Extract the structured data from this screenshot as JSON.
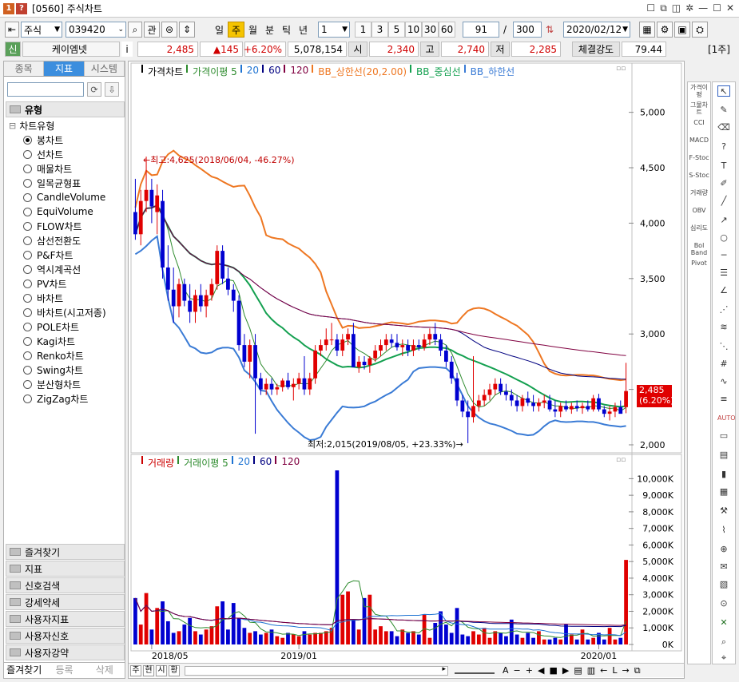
{
  "window": {
    "icon_num": "1",
    "icon_q": "?",
    "title": "[0560] 주식차트"
  },
  "toolbar": {
    "market": "주식",
    "code": "039420",
    "btn_gwan": "관",
    "periods": [
      "일",
      "주",
      "월",
      "분",
      "틱",
      "년"
    ],
    "period_active": "주",
    "interval": "1",
    "quick": [
      "1",
      "3",
      "5",
      "10",
      "30",
      "60"
    ],
    "count": "91",
    "count_sep": "/",
    "total": "300",
    "date": "2020/02/12"
  },
  "quote": {
    "tag": "신",
    "name": "케이엠넷",
    "info": "i",
    "price": "2,485",
    "change": "▲145",
    "change_pct": "+6.20%",
    "volume": "5,078,154",
    "open_label": "시",
    "open": "2,340",
    "high_label": "고",
    "high": "2,740",
    "low_label": "저",
    "low": "2,285",
    "strength_label": "체결강도",
    "strength": "79.44",
    "unit": "[1주]"
  },
  "sidebar": {
    "tabs": [
      "종목",
      "지표",
      "시스템"
    ],
    "active_tab": "지표",
    "group_title": "유형",
    "tree_root": "차트유형",
    "items": [
      "봉차트",
      "선차트",
      "매물차트",
      "일목균형표",
      "CandleVolume",
      "EquiVolume",
      "FLOW차트",
      "삼선전환도",
      "P&F차트",
      "역시계곡선",
      "PV차트",
      "바차트",
      "바차트(시고저종)",
      "POLE차트",
      "Kagi차트",
      "Renko차트",
      "Swing차트",
      "분산형차트",
      "ZigZag차트"
    ],
    "selected": "봉차트",
    "groups": [
      "즐겨찾기",
      "지표",
      "신호검색",
      "강세약세",
      "사용자지표",
      "사용자신호",
      "사용자강약"
    ],
    "bottom_tabs": [
      "즐겨찾기",
      "등록",
      "삭제"
    ]
  },
  "price_panel": {
    "legend": [
      {
        "text": "가격차트",
        "color": "#000000"
      },
      {
        "text": "가격이평 5",
        "color": "#2e8b2e"
      },
      {
        "text": "20",
        "color": "#1e73d2"
      },
      {
        "text": "60",
        "color": "#000080"
      },
      {
        "text": "120",
        "color": "#800040"
      },
      {
        "text": "BB_상한선(20,2.00)",
        "color": "#ee7722"
      },
      {
        "text": "BB_중심선",
        "color": "#14a050"
      },
      {
        "text": "BB_하한선",
        "color": "#3a7bd5"
      }
    ],
    "yticks": [
      "5,000",
      "4,500",
      "4,000",
      "3,500",
      "3,000",
      "2,500",
      "2,000"
    ],
    "high_note": "←최고:4,625(2018/06/04, -46.27%)",
    "low_note": "최저:2,015(2019/08/05, +23.33%)→",
    "last_price": "2,485",
    "last_pct": "(6.20%)"
  },
  "volume_panel": {
    "legend": [
      {
        "text": "거래량",
        "color": "#cc0000"
      },
      {
        "text": "거래이평 5",
        "color": "#2e8b2e"
      },
      {
        "text": "20",
        "color": "#1e73d2"
      },
      {
        "text": "60",
        "color": "#000080"
      },
      {
        "text": "120",
        "color": "#800040"
      }
    ],
    "yticks": [
      "10,000K",
      "9,000K",
      "8,000K",
      "7,000K",
      "6,000K",
      "5,000K",
      "4,000K",
      "3,000K",
      "2,000K",
      "1,000K",
      "0K"
    ]
  },
  "xaxis": {
    "labels": [
      "2018/05",
      "2019/01",
      "2020/01"
    ]
  },
  "navbar": {
    "buttons": [
      "주",
      "현",
      "시",
      "황"
    ]
  },
  "right_tools": [
    "가격이평",
    "그물차트",
    "CCI",
    "MACD",
    "F-Stoc",
    "S-Stoc",
    "거래량",
    "OBV",
    "심리도",
    "Bol Band",
    "Pivot"
  ],
  "chart_data": [
    {
      "type": "candlestick",
      "y_range": [
        2000,
        5300
      ],
      "ohlc_approx": [
        [
          4100,
          4400,
          3850,
          3900
        ],
        [
          3900,
          4300,
          3800,
          4200
        ],
        [
          4200,
          4600,
          4100,
          4300
        ],
        [
          4300,
          4400,
          4000,
          4150
        ],
        [
          4100,
          4350,
          3900,
          4250
        ],
        [
          4200,
          4300,
          3500,
          3600
        ],
        [
          3600,
          3800,
          3300,
          3400
        ],
        [
          3400,
          3600,
          3100,
          3250
        ],
        [
          3250,
          3500,
          3150,
          3450
        ],
        [
          3450,
          3500,
          3250,
          3300
        ],
        [
          3300,
          3450,
          3100,
          3200
        ],
        [
          3200,
          3400,
          3100,
          3350
        ],
        [
          3350,
          3450,
          3200,
          3250
        ],
        [
          3250,
          3400,
          3150,
          3350
        ],
        [
          3350,
          3500,
          3300,
          3450
        ],
        [
          3450,
          3800,
          3400,
          3750
        ],
        [
          3750,
          3800,
          3450,
          3500
        ],
        [
          3500,
          3600,
          3350,
          3400
        ],
        [
          3400,
          3450,
          3200,
          3300
        ],
        [
          3300,
          3350,
          2850,
          2900
        ],
        [
          2900,
          3000,
          2700,
          2750
        ],
        [
          2750,
          2950,
          2600,
          2900
        ],
        [
          2900,
          3000,
          2100,
          2600
        ],
        [
          2600,
          2650,
          2450,
          2500
        ],
        [
          2500,
          2600,
          2450,
          2550
        ],
        [
          2550,
          2600,
          2450,
          2500
        ],
        [
          2500,
          2550,
          2450,
          2520
        ],
        [
          2520,
          2600,
          2480,
          2580
        ],
        [
          2580,
          2650,
          2500,
          2520
        ],
        [
          2520,
          2600,
          2400,
          2550
        ],
        [
          2550,
          2650,
          2500,
          2600
        ],
        [
          2600,
          2800,
          2450,
          2500
        ],
        [
          2500,
          2650,
          2450,
          2600
        ],
        [
          2600,
          2900,
          2550,
          2850
        ],
        [
          2850,
          2950,
          2800,
          2900
        ],
        [
          2900,
          3050,
          2850,
          2950
        ],
        [
          2950,
          3100,
          2900,
          2950
        ],
        [
          2950,
          3000,
          2800,
          2850
        ],
        [
          2850,
          3000,
          2800,
          2950
        ],
        [
          2950,
          3050,
          2900,
          3000
        ],
        [
          3000,
          3100,
          2850,
          2700
        ],
        [
          2700,
          2800,
          2650,
          2750
        ],
        [
          2750,
          2800,
          2680,
          2720
        ],
        [
          2720,
          2800,
          2650,
          2780
        ],
        [
          2780,
          2900,
          2750,
          2850
        ],
        [
          2850,
          2950,
          2800,
          2900
        ],
        [
          2900,
          3000,
          2850,
          2950
        ],
        [
          2950,
          3000,
          2880,
          2920
        ],
        [
          2920,
          3000,
          2850,
          2880
        ],
        [
          2880,
          2950,
          2800,
          2900
        ],
        [
          2900,
          2950,
          2800,
          2850
        ],
        [
          2850,
          2950,
          2800,
          2900
        ],
        [
          2900,
          2950,
          2850,
          2880
        ],
        [
          2880,
          3000,
          2850,
          2950
        ],
        [
          2950,
          3050,
          2900,
          3000
        ],
        [
          3000,
          3100,
          2900,
          2950
        ],
        [
          2950,
          3000,
          2800,
          2850
        ],
        [
          2850,
          2900,
          2700,
          2750
        ],
        [
          2750,
          2800,
          2550,
          2600
        ],
        [
          2600,
          2650,
          2350,
          2400
        ],
        [
          2400,
          2450,
          2250,
          2300
        ],
        [
          2300,
          2400,
          2015,
          2250
        ],
        [
          2250,
          2800,
          2200,
          2350
        ],
        [
          2350,
          2450,
          2300,
          2400
        ],
        [
          2400,
          2500,
          2350,
          2450
        ],
        [
          2450,
          2550,
          2400,
          2500
        ],
        [
          2500,
          2600,
          2450,
          2550
        ],
        [
          2550,
          2600,
          2450,
          2480
        ],
        [
          2480,
          2550,
          2400,
          2450
        ],
        [
          2450,
          2500,
          2350,
          2400
        ],
        [
          2400,
          2450,
          2300,
          2350
        ],
        [
          2350,
          2450,
          2300,
          2420
        ],
        [
          2420,
          2480,
          2350,
          2380
        ],
        [
          2380,
          2450,
          2300,
          2350
        ],
        [
          2350,
          2420,
          2300,
          2380
        ],
        [
          2380,
          2450,
          2330,
          2400
        ],
        [
          2400,
          2450,
          2300,
          2320
        ],
        [
          2320,
          2400,
          2250,
          2300
        ],
        [
          2300,
          2380,
          2250,
          2350
        ],
        [
          2350,
          2400,
          2300,
          2320
        ],
        [
          2320,
          2380,
          2280,
          2350
        ],
        [
          2350,
          2400,
          2300,
          2330
        ],
        [
          2330,
          2380,
          2280,
          2350
        ],
        [
          2350,
          2400,
          2300,
          2320
        ],
        [
          2320,
          2450,
          2300,
          2420
        ],
        [
          2420,
          2460,
          2300,
          2320
        ],
        [
          2320,
          2350,
          2250,
          2280
        ],
        [
          2280,
          2350,
          2220,
          2300
        ],
        [
          2300,
          2380,
          2250,
          2340
        ],
        [
          2340,
          2400,
          2285,
          2280
        ],
        [
          2340,
          2740,
          2285,
          2485
        ]
      ]
    },
    {
      "type": "bar",
      "unit": "K",
      "y_range": [
        0,
        10500
      ],
      "values": [
        2800,
        1200,
        3100,
        900,
        2200,
        2600,
        1400,
        700,
        800,
        1200,
        1600,
        800,
        600,
        900,
        1100,
        2300,
        2600,
        900,
        2500,
        1600,
        1000,
        700,
        800,
        600,
        700,
        900,
        500,
        400,
        700,
        600,
        500,
        800,
        600,
        700,
        700,
        800,
        1000,
        10500,
        3000,
        3200,
        1500,
        900,
        2800,
        3000,
        900,
        1100,
        800,
        800,
        500,
        900,
        700,
        800,
        600,
        1800,
        400,
        1300,
        2000,
        1200,
        700,
        2200,
        600,
        500,
        800,
        600,
        1000,
        400,
        800,
        700,
        500,
        1500,
        600,
        400,
        700,
        400,
        800,
        300,
        300,
        400,
        300,
        1200,
        600,
        300,
        900,
        300,
        400,
        700,
        300,
        1000,
        300,
        400,
        5100
      ]
    }
  ]
}
